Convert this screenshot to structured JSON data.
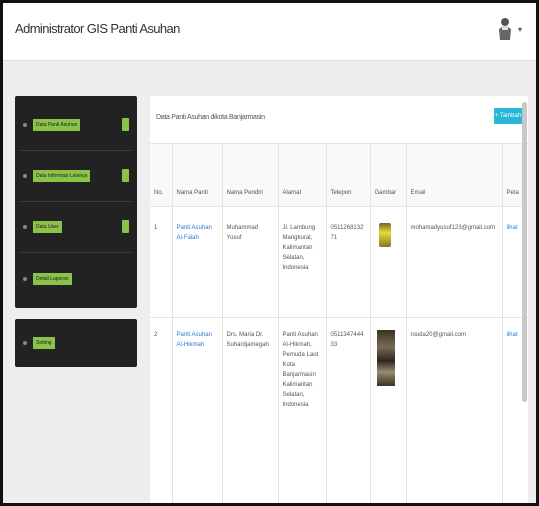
{
  "app": {
    "title": "Administrator GIS Panti Asuhan"
  },
  "user": {
    "caret": "▾"
  },
  "sidebar": {
    "items": [
      {
        "label": "Data Panti Asuhan"
      },
      {
        "label": "Data Informasi Lainnya"
      },
      {
        "label": "Data User"
      },
      {
        "label": "Detail Laporan"
      }
    ],
    "settings_label": "Setting"
  },
  "content": {
    "title": "Data Panti Asuhan dikota Banjarmasin",
    "add_label": "+ Tambah",
    "columns": [
      "No.",
      "Nama Panti",
      "Nama Pendiri",
      "Alamat",
      "Telepon",
      "Gambar",
      "Email",
      "Peta"
    ],
    "rows": [
      {
        "no": "1",
        "nama_panti": "Panti Asuhan Al-Falah",
        "pendiri": "Muhammad Yusuf",
        "alamat": "Jl. Lambung Mangkurat, Kalimantan Selatan, Indonesia",
        "telepon": "051126813271",
        "email": "mohamadyusuf123@gmail.com",
        "peta": "lihat"
      },
      {
        "no": "2",
        "nama_panti": "Panti Asuhan Al-Hikmah",
        "pendiri": "Drs. Maria Dr. Suhardjamegah",
        "alamat": "Panti Asuhan Al-Hikmah, Pemuda Laut Kota Banjarmasin Kalimantan Selatan, Indonesia",
        "telepon": "051134744433",
        "email": "rouda20@gmail.com",
        "peta": "lihat"
      }
    ]
  }
}
